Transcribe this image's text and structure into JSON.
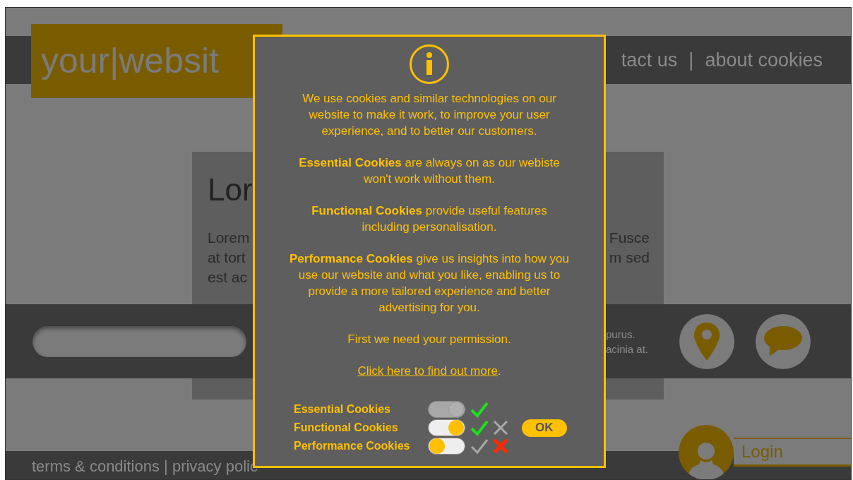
{
  "site": {
    "logo": "your|websit",
    "nav": [
      "tact us",
      "|",
      "about cookies"
    ],
    "content": {
      "heading": "Lor",
      "left_lines": [
        "Lorem",
        "at tort",
        "est ac"
      ],
      "right_lines": [
        "Fusce",
        "m sed"
      ]
    },
    "band_lines": [
      "purus.",
      "acinia at."
    ],
    "login": "Login",
    "footer": "terms & conditions | privacy polic"
  },
  "dialog": {
    "paragraphs": [
      "We use cookies and similar technologies on our website to make it work, to improve your user experience, and to better our customers.",
      "**Essential Cookies** are always on as our webiste won't work without them.",
      "**Functional Cookies** provide useful features including personalisation.",
      "**Performance Cookies** give us insights into how you use our website and what you like, enabling us to provide a more tailored experience and better advertising for you.",
      "First we need your permission."
    ],
    "link": "Click here to find out more",
    "link_after": ".",
    "cookies": [
      {
        "label": "Essential Cookies",
        "on": true,
        "disabled": true
      },
      {
        "label": "Functional Cookies",
        "on": true,
        "disabled": false
      },
      {
        "label": "Performance Cookies",
        "on": false,
        "disabled": false
      }
    ],
    "ok": "OK"
  }
}
